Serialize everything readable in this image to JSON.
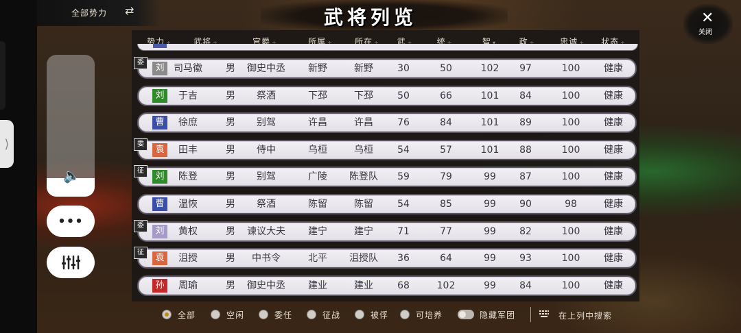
{
  "top": {
    "faction_switch": "全部势力",
    "swap_icon": "⇄",
    "title": "武将列览",
    "close_label": "关闭"
  },
  "controls": {
    "volume_level": 0.13,
    "more_label": "•••"
  },
  "table": {
    "headers": [
      "势力",
      "武将",
      "官爵",
      "所属",
      "所在",
      "武",
      "统",
      "智",
      "政",
      "忠诚",
      "状态"
    ],
    "sort_marks": [
      "÷",
      "÷",
      "÷",
      "÷",
      "÷",
      "÷",
      "÷",
      "▾",
      "÷",
      "÷",
      "÷"
    ],
    "rows": [
      {
        "tag": "委",
        "faction": "刘",
        "faction_color": "#8a8a8a",
        "name": "司马徽",
        "gender": "男",
        "rank": "御史中丞",
        "belong": "新野",
        "location": "新野",
        "wu": "30",
        "tong": "50",
        "zhi": "102",
        "zheng": "97",
        "loyalty": "100",
        "status": "健康"
      },
      {
        "tag": "",
        "faction": "刘",
        "faction_color": "#2f8a2a",
        "name": "于吉",
        "gender": "男",
        "rank": "祭酒",
        "belong": "下邳",
        "location": "下邳",
        "wu": "50",
        "tong": "66",
        "zhi": "101",
        "zheng": "84",
        "loyalty": "100",
        "status": "健康"
      },
      {
        "tag": "",
        "faction": "曹",
        "faction_color": "#3b4ea8",
        "name": "徐庶",
        "gender": "男",
        "rank": "别驾",
        "belong": "许昌",
        "location": "许昌",
        "wu": "76",
        "tong": "84",
        "zhi": "101",
        "zheng": "89",
        "loyalty": "100",
        "status": "健康"
      },
      {
        "tag": "委",
        "faction": "袁",
        "faction_color": "#d8663e",
        "name": "田丰",
        "gender": "男",
        "rank": "侍中",
        "belong": "乌桓",
        "location": "乌桓",
        "wu": "54",
        "tong": "57",
        "zhi": "101",
        "zheng": "88",
        "loyalty": "100",
        "status": "健康"
      },
      {
        "tag": "征",
        "faction": "刘",
        "faction_color": "#2f8a2a",
        "name": "陈登",
        "gender": "男",
        "rank": "别驾",
        "belong": "广陵",
        "location": "陈登队",
        "wu": "59",
        "tong": "79",
        "zhi": "99",
        "zheng": "87",
        "loyalty": "100",
        "status": "健康"
      },
      {
        "tag": "",
        "faction": "曹",
        "faction_color": "#3b4ea8",
        "name": "温恢",
        "gender": "男",
        "rank": "祭酒",
        "belong": "陈留",
        "location": "陈留",
        "wu": "54",
        "tong": "85",
        "zhi": "99",
        "zheng": "90",
        "loyalty": "98",
        "status": "健康"
      },
      {
        "tag": "委",
        "faction": "刘",
        "faction_color": "#a69ac8",
        "name": "黄权",
        "gender": "男",
        "rank": "谏议大夫",
        "belong": "建宁",
        "location": "建宁",
        "wu": "71",
        "tong": "77",
        "zhi": "99",
        "zheng": "82",
        "loyalty": "100",
        "status": "健康"
      },
      {
        "tag": "征",
        "faction": "袁",
        "faction_color": "#d8663e",
        "name": "沮授",
        "gender": "男",
        "rank": "中书令",
        "belong": "北平",
        "location": "沮授队",
        "wu": "36",
        "tong": "64",
        "zhi": "99",
        "zheng": "93",
        "loyalty": "100",
        "status": "健康"
      },
      {
        "tag": "",
        "faction": "孙",
        "faction_color": "#c42828",
        "name": "周瑜",
        "gender": "男",
        "rank": "御史中丞",
        "belong": "建业",
        "location": "建业",
        "wu": "68",
        "tong": "102",
        "zhi": "99",
        "zheng": "84",
        "loyalty": "100",
        "status": "健康"
      }
    ]
  },
  "filters": {
    "options": [
      "全部",
      "空闲",
      "委任",
      "征战",
      "被俘",
      "可培养"
    ],
    "selected": 0,
    "hide_army_label": "隐藏军团",
    "hide_army_on": false,
    "search_label": "在上列中搜索"
  }
}
